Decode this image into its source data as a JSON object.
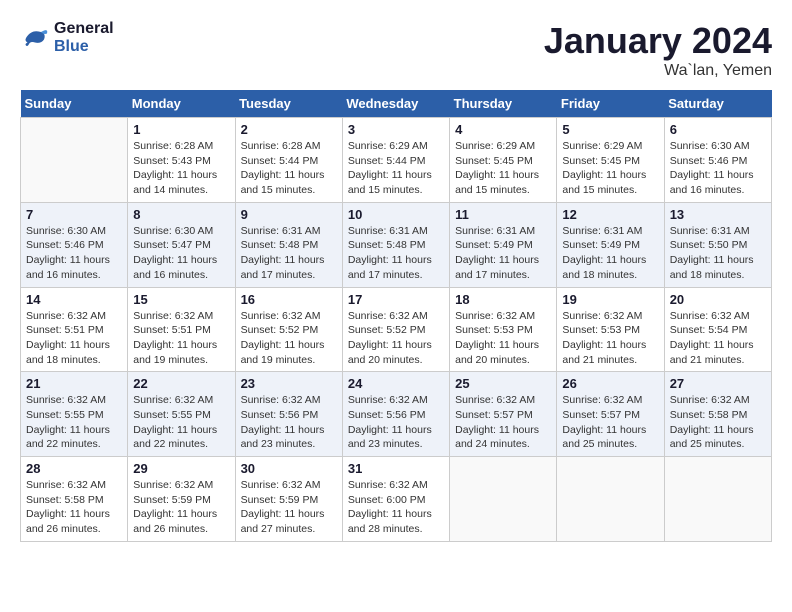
{
  "logo": {
    "line1": "General",
    "line2": "Blue"
  },
  "title": "January 2024",
  "subtitle": "Wa`lan, Yemen",
  "weekdays": [
    "Sunday",
    "Monday",
    "Tuesday",
    "Wednesday",
    "Thursday",
    "Friday",
    "Saturday"
  ],
  "weeks": [
    [
      {
        "day": "",
        "info": ""
      },
      {
        "day": "1",
        "info": "Sunrise: 6:28 AM\nSunset: 5:43 PM\nDaylight: 11 hours\nand 14 minutes."
      },
      {
        "day": "2",
        "info": "Sunrise: 6:28 AM\nSunset: 5:44 PM\nDaylight: 11 hours\nand 15 minutes."
      },
      {
        "day": "3",
        "info": "Sunrise: 6:29 AM\nSunset: 5:44 PM\nDaylight: 11 hours\nand 15 minutes."
      },
      {
        "day": "4",
        "info": "Sunrise: 6:29 AM\nSunset: 5:45 PM\nDaylight: 11 hours\nand 15 minutes."
      },
      {
        "day": "5",
        "info": "Sunrise: 6:29 AM\nSunset: 5:45 PM\nDaylight: 11 hours\nand 15 minutes."
      },
      {
        "day": "6",
        "info": "Sunrise: 6:30 AM\nSunset: 5:46 PM\nDaylight: 11 hours\nand 16 minutes."
      }
    ],
    [
      {
        "day": "7",
        "info": "Sunrise: 6:30 AM\nSunset: 5:46 PM\nDaylight: 11 hours\nand 16 minutes."
      },
      {
        "day": "8",
        "info": "Sunrise: 6:30 AM\nSunset: 5:47 PM\nDaylight: 11 hours\nand 16 minutes."
      },
      {
        "day": "9",
        "info": "Sunrise: 6:31 AM\nSunset: 5:48 PM\nDaylight: 11 hours\nand 17 minutes."
      },
      {
        "day": "10",
        "info": "Sunrise: 6:31 AM\nSunset: 5:48 PM\nDaylight: 11 hours\nand 17 minutes."
      },
      {
        "day": "11",
        "info": "Sunrise: 6:31 AM\nSunset: 5:49 PM\nDaylight: 11 hours\nand 17 minutes."
      },
      {
        "day": "12",
        "info": "Sunrise: 6:31 AM\nSunset: 5:49 PM\nDaylight: 11 hours\nand 18 minutes."
      },
      {
        "day": "13",
        "info": "Sunrise: 6:31 AM\nSunset: 5:50 PM\nDaylight: 11 hours\nand 18 minutes."
      }
    ],
    [
      {
        "day": "14",
        "info": "Sunrise: 6:32 AM\nSunset: 5:51 PM\nDaylight: 11 hours\nand 18 minutes."
      },
      {
        "day": "15",
        "info": "Sunrise: 6:32 AM\nSunset: 5:51 PM\nDaylight: 11 hours\nand 19 minutes."
      },
      {
        "day": "16",
        "info": "Sunrise: 6:32 AM\nSunset: 5:52 PM\nDaylight: 11 hours\nand 19 minutes."
      },
      {
        "day": "17",
        "info": "Sunrise: 6:32 AM\nSunset: 5:52 PM\nDaylight: 11 hours\nand 20 minutes."
      },
      {
        "day": "18",
        "info": "Sunrise: 6:32 AM\nSunset: 5:53 PM\nDaylight: 11 hours\nand 20 minutes."
      },
      {
        "day": "19",
        "info": "Sunrise: 6:32 AM\nSunset: 5:53 PM\nDaylight: 11 hours\nand 21 minutes."
      },
      {
        "day": "20",
        "info": "Sunrise: 6:32 AM\nSunset: 5:54 PM\nDaylight: 11 hours\nand 21 minutes."
      }
    ],
    [
      {
        "day": "21",
        "info": "Sunrise: 6:32 AM\nSunset: 5:55 PM\nDaylight: 11 hours\nand 22 minutes."
      },
      {
        "day": "22",
        "info": "Sunrise: 6:32 AM\nSunset: 5:55 PM\nDaylight: 11 hours\nand 22 minutes."
      },
      {
        "day": "23",
        "info": "Sunrise: 6:32 AM\nSunset: 5:56 PM\nDaylight: 11 hours\nand 23 minutes."
      },
      {
        "day": "24",
        "info": "Sunrise: 6:32 AM\nSunset: 5:56 PM\nDaylight: 11 hours\nand 23 minutes."
      },
      {
        "day": "25",
        "info": "Sunrise: 6:32 AM\nSunset: 5:57 PM\nDaylight: 11 hours\nand 24 minutes."
      },
      {
        "day": "26",
        "info": "Sunrise: 6:32 AM\nSunset: 5:57 PM\nDaylight: 11 hours\nand 25 minutes."
      },
      {
        "day": "27",
        "info": "Sunrise: 6:32 AM\nSunset: 5:58 PM\nDaylight: 11 hours\nand 25 minutes."
      }
    ],
    [
      {
        "day": "28",
        "info": "Sunrise: 6:32 AM\nSunset: 5:58 PM\nDaylight: 11 hours\nand 26 minutes."
      },
      {
        "day": "29",
        "info": "Sunrise: 6:32 AM\nSunset: 5:59 PM\nDaylight: 11 hours\nand 26 minutes."
      },
      {
        "day": "30",
        "info": "Sunrise: 6:32 AM\nSunset: 5:59 PM\nDaylight: 11 hours\nand 27 minutes."
      },
      {
        "day": "31",
        "info": "Sunrise: 6:32 AM\nSunset: 6:00 PM\nDaylight: 11 hours\nand 28 minutes."
      },
      {
        "day": "",
        "info": ""
      },
      {
        "day": "",
        "info": ""
      },
      {
        "day": "",
        "info": ""
      }
    ]
  ]
}
